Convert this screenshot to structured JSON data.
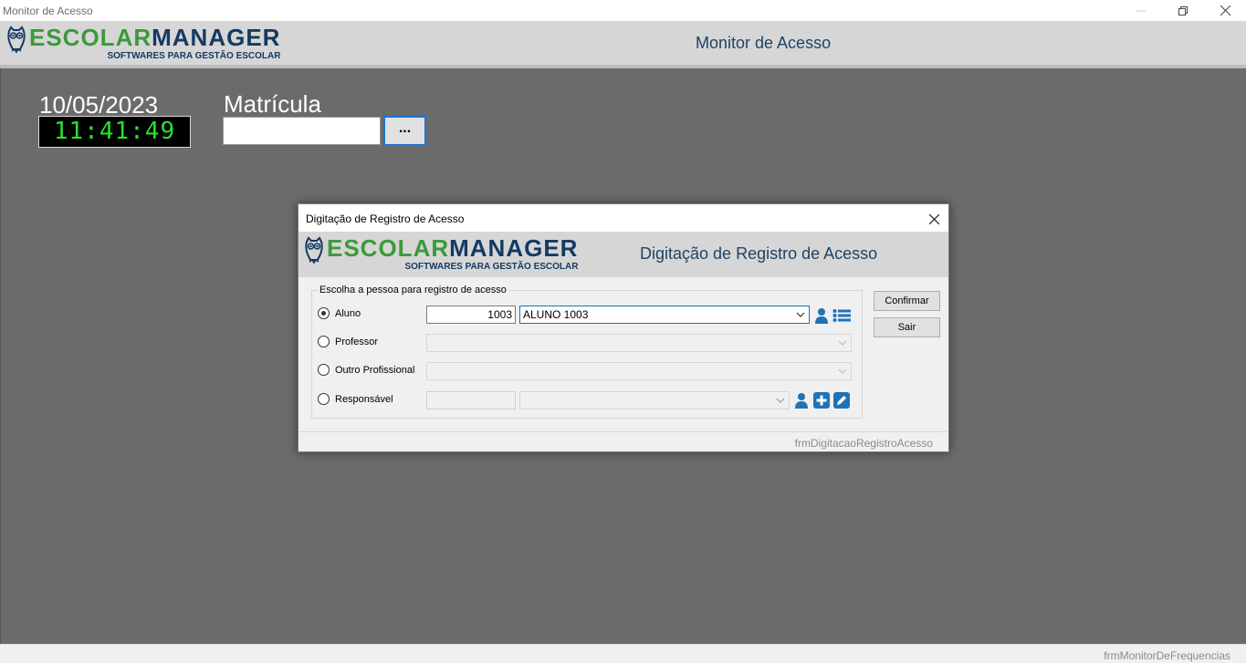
{
  "window": {
    "title": "Monitor de Acesso",
    "minimize_icon": "minimize-icon",
    "restore_icon": "restore-icon",
    "close_icon": "close-icon"
  },
  "header": {
    "logo_escolar": "ESCOLAR",
    "logo_manager": "MANAGER",
    "logo_tagline": "SOFTWARES PARA GESTÃO ESCOLAR",
    "title": "Monitor de Acesso"
  },
  "main": {
    "date": "10/05/2023",
    "time": "11:41:49",
    "matricula_label": "Matrícula",
    "matricula_value": "",
    "browse_button": "..."
  },
  "statusbar": {
    "form_name": "frmMonitorDeFrequencias"
  },
  "dialog": {
    "title": "Digitação de Registro de Acesso",
    "header_title": "Digitação de Registro de Acesso",
    "group_label": "Escolha a pessoa para registro de acesso",
    "rows": [
      {
        "label": "Aluno",
        "checked": true,
        "code": "1003",
        "name": "ALUNO 1003"
      },
      {
        "label": "Professor",
        "checked": false,
        "name": ""
      },
      {
        "label": "Outro Profissional",
        "checked": false,
        "name": ""
      },
      {
        "label": "Responsável",
        "checked": false,
        "code": "",
        "name": ""
      }
    ],
    "confirm_button": "Confirmar",
    "exit_button": "Sair",
    "form_name": "frmDigitacaoRegistroAcesso"
  },
  "colors": {
    "main_background": "#6b6b6b",
    "header_background": "#d6d6d6",
    "clock_text": "#2be02b",
    "logo_green": "#3b9a3a",
    "logo_navy": "#143a63",
    "icon_blue": "#1f73b7"
  }
}
